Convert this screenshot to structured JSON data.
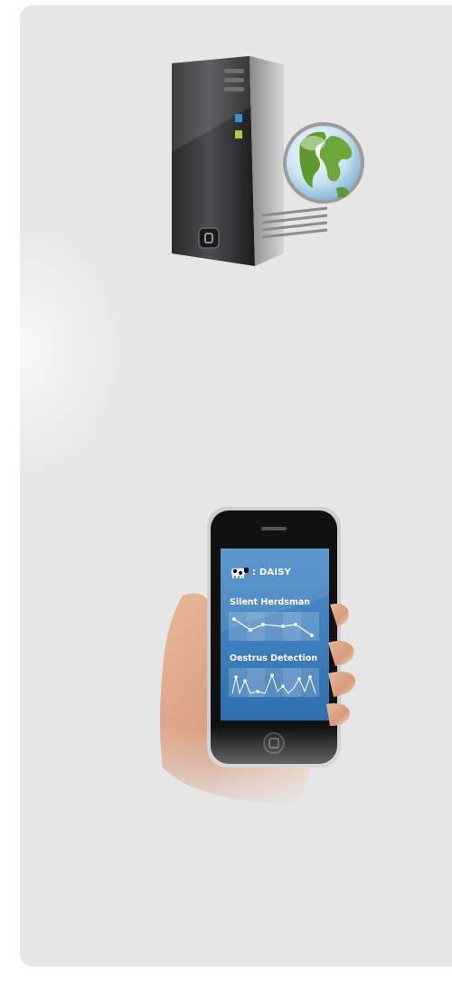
{
  "server": {
    "icon": "web-server-globe-icon"
  },
  "phone": {
    "icon": "smartphone-in-hand-icon",
    "cow_name": ": DAISY",
    "section1_title": "Silent Herdsman",
    "section2_title": "Oestrus Detection",
    "colors": {
      "screen": "#3a7fc0",
      "accent": "#ffffff"
    }
  }
}
